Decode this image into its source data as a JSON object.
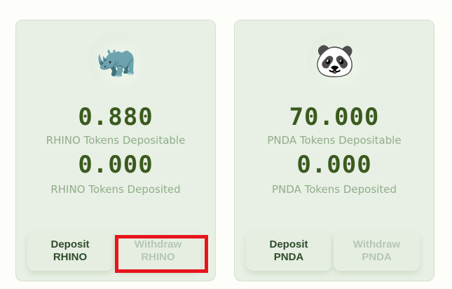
{
  "cards": [
    {
      "icon": "rhino-icon",
      "emoji": "🦏",
      "depositable": "0.880",
      "depositable_label": "RHINO Tokens Depositable",
      "deposited": "0.000",
      "deposited_label": "RHINO Tokens Deposited",
      "deposit_line1": "Deposit",
      "deposit_line2": "RHINO",
      "withdraw_line1": "Withdraw",
      "withdraw_line2": "RHINO"
    },
    {
      "icon": "panda-icon",
      "emoji": "🐼",
      "depositable": "70.000",
      "depositable_label": "PNDA Tokens Depositable",
      "deposited": "0.000",
      "deposited_label": "PNDA Tokens Deposited",
      "deposit_line1": "Deposit",
      "deposit_line2": "PNDA",
      "withdraw_line1": "Withdraw",
      "withdraw_line2": "PNDA"
    }
  ],
  "highlight_color": "#e8141c"
}
